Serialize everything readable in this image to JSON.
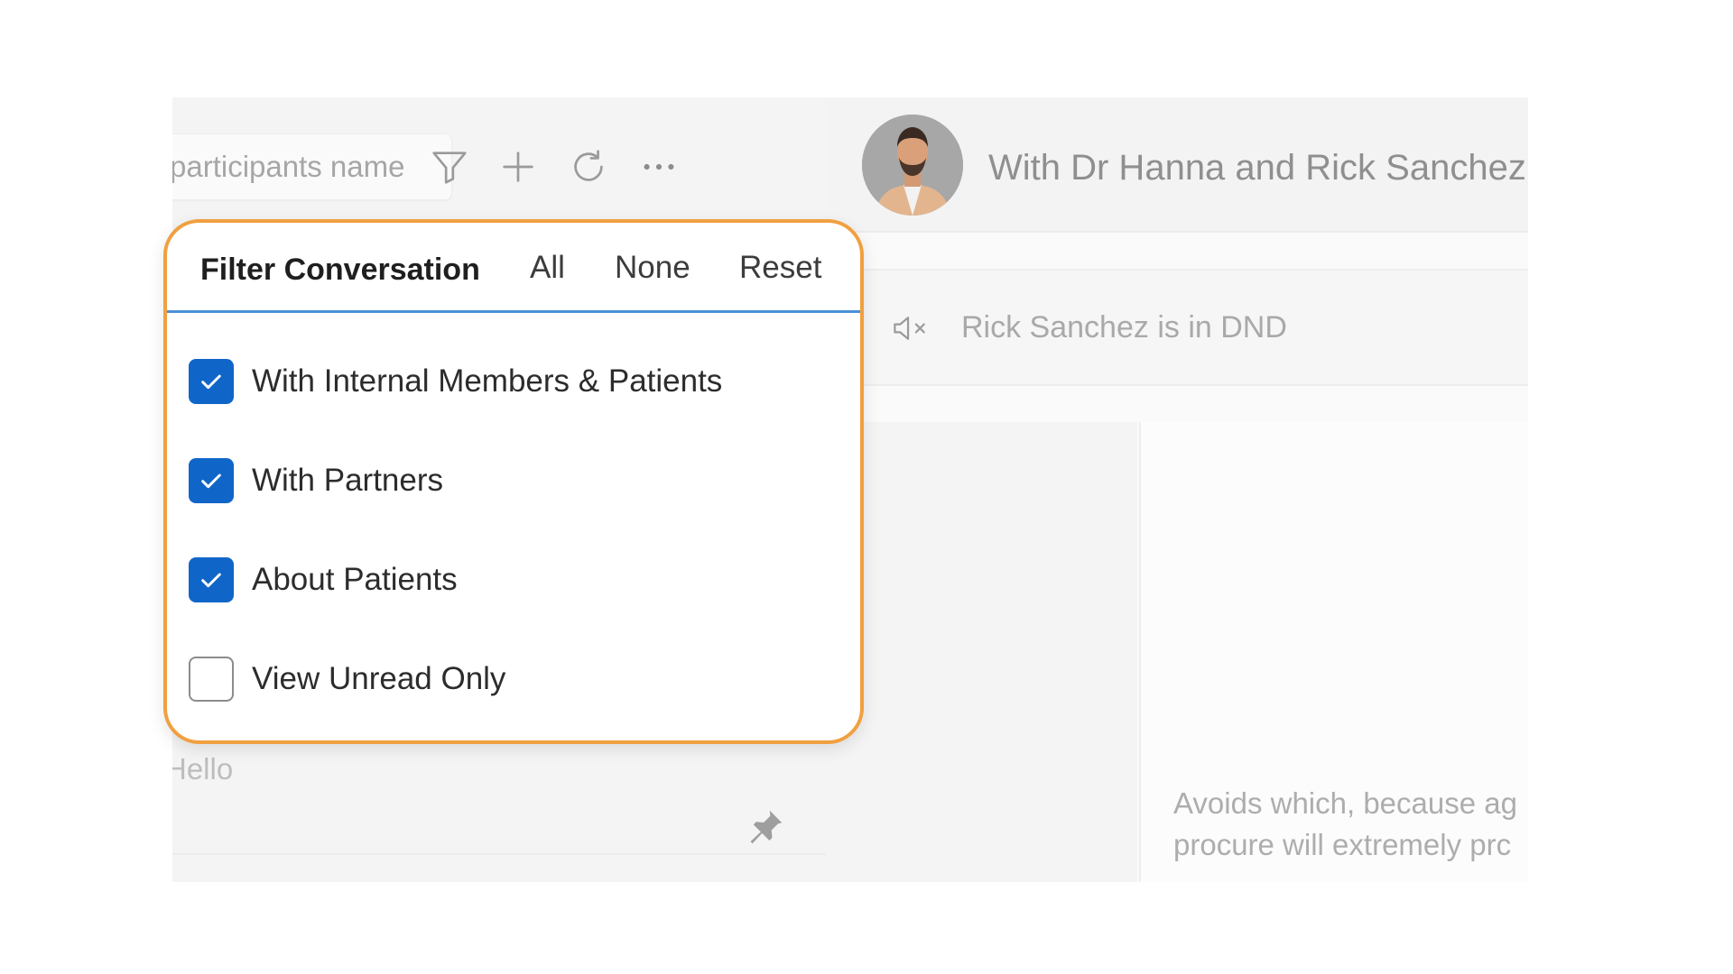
{
  "search": {
    "placeholder": "participants name"
  },
  "toolbar": {
    "icons": [
      "filter-icon",
      "plus-icon",
      "refresh-icon",
      "more-icon"
    ]
  },
  "filter": {
    "title": "Filter Conversation",
    "actions": {
      "all": "All",
      "none": "None",
      "reset": "Reset"
    },
    "options": [
      {
        "label": "With Internal Members & Patients",
        "checked": true
      },
      {
        "label": "With Partners",
        "checked": true
      },
      {
        "label": "About Patients",
        "checked": true
      },
      {
        "label": "View Unread Only",
        "checked": false
      }
    ]
  },
  "conversation_preview": {
    "text": "Hello",
    "icon": "pin-icon"
  },
  "chat": {
    "title": "With Dr Hanna and Rick Sanchez",
    "dnd_text": "Rick Sanchez is in DND",
    "dnd_icon": "speaker-muted-icon",
    "message_line1": "Avoids which, because ag",
    "message_line2": "procure will extremely prc"
  },
  "colors": {
    "accent_blue": "#1066c8",
    "highlight_orange": "#f0a040",
    "header_underline": "#4a90d9"
  }
}
